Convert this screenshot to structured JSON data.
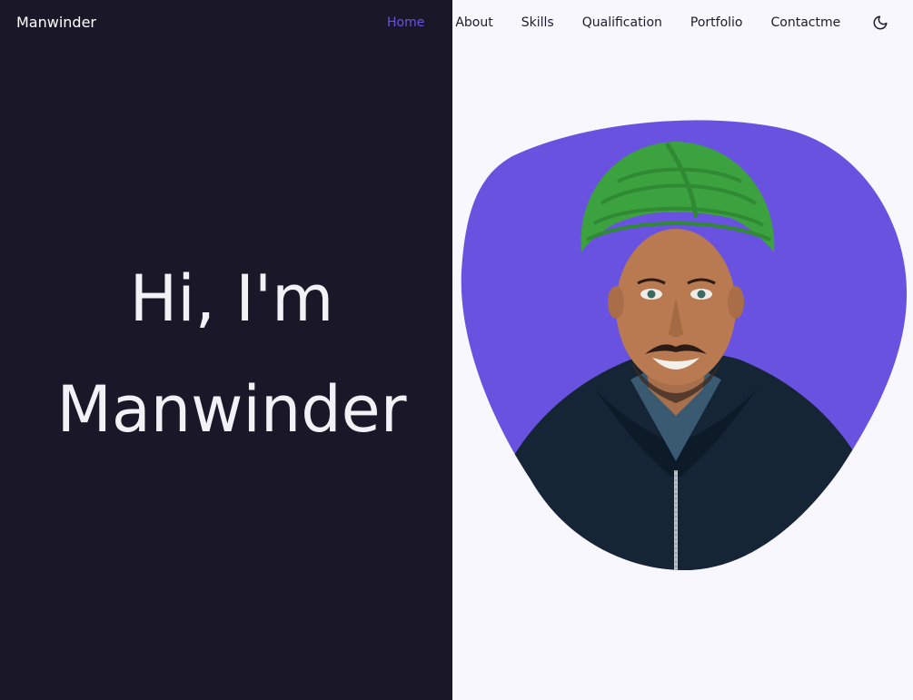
{
  "header": {
    "brand": "Manwinder",
    "nav": [
      {
        "label": "Home",
        "active": true
      },
      {
        "label": "About",
        "active": false
      },
      {
        "label": "Skills",
        "active": false
      },
      {
        "label": "Qualification",
        "active": false
      },
      {
        "label": "Portfolio",
        "active": false
      },
      {
        "label": "Contactme",
        "active": false
      }
    ],
    "theme_toggle_icon": "moon-icon"
  },
  "hero": {
    "title_line1": "Hi, I'm",
    "title_line2": "Manwinder",
    "subtitle": "",
    "cta_label": ""
  },
  "profile": {
    "image_icon": "profile-photo",
    "blob_color": "#6a52e0",
    "turban_color": "#3ca23f",
    "hoodie_color": "#152535"
  },
  "colors": {
    "accent": "#6a52e0",
    "dark_bg": "#1a1828",
    "light_bg": "#f8f7fe"
  }
}
